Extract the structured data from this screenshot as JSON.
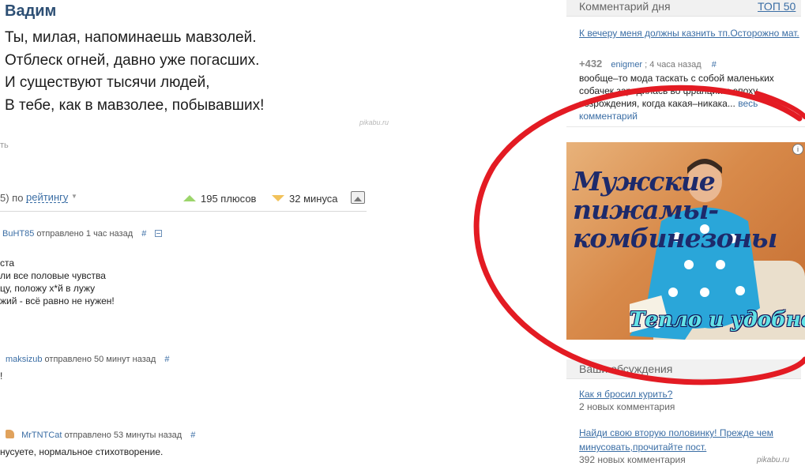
{
  "poem": {
    "author": "Вадим",
    "lines": [
      "Ты, милая, напоминаешь мавзолей.",
      "Отблеск огней, давно уже погасших.",
      "И существуют тысячи людей,",
      "В тебе, как в мавзолее, побывавших!"
    ],
    "watermark": "pikabu.ru"
  },
  "post_actions": {
    "cut_text": "ть"
  },
  "rating_bar": {
    "sort_prefix": "5) по",
    "sort_link": "рейтингу",
    "pluses": "195 плюсов",
    "minuses": "32 минуса"
  },
  "comments": [
    {
      "user": "BuHT85",
      "meta": "отправлено 1 час назад",
      "hash": "#",
      "lines": [
        "ста",
        "ли все половые чувства",
        "цу, положу х*й в лужу",
        "жий - всё равно не нужен!"
      ]
    },
    {
      "user": "maksizub",
      "meta": "отправлено 50 минут назад",
      "hash": "#",
      "lines": [
        "!"
      ]
    },
    {
      "user": "MrTNTCat",
      "meta": "отправлено 53 минуты назад",
      "hash": "#",
      "lines": [
        "нусуете, нормальное стихотворение."
      ]
    }
  ],
  "comment_of_day": {
    "title": "Комментарий дня",
    "top_link": "ТОП 50",
    "post_link": "К вечеру меня должны казнить тп.Осторожно мат.",
    "score": "+432",
    "user": "enigmer",
    "time": "; 4 часа назад",
    "hash": "#",
    "body": "вообще–то мода таскать с собой маленьких собачек зародилась во франции в эпоху возрождения, когда какая–никака...",
    "more": "весь комментарий"
  },
  "ad": {
    "headline": [
      "Мужские",
      "пижамы-",
      "комбинезоны"
    ],
    "tagline": "Тепло и удобно!",
    "info": "i"
  },
  "discussions": {
    "title": "Ваши обсуждения",
    "items": [
      {
        "link": "Как я бросил курить?",
        "sub": "2 новых комментария"
      },
      {
        "link": "Найди свою вторую половинку! Прежде чем минусовать,прочитайте пост.",
        "sub": "392 новых комментария"
      }
    ]
  },
  "footer_watermark": "pikabu.ru",
  "colors": {
    "link": "#3b6ea5",
    "author": "#2d4f74",
    "plus": "#9cd56b",
    "minus": "#f2c25a",
    "scribble": "#e31b23"
  }
}
